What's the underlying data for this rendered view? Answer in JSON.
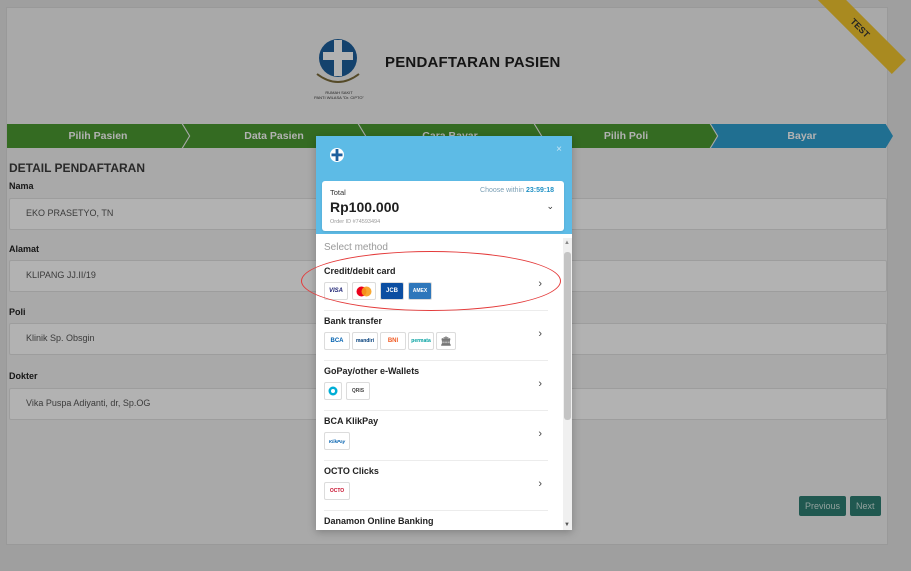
{
  "header": {
    "title": "PENDAFTARAN PASIEN",
    "logo_text_1": "RUMAH SAKIT",
    "logo_text_2": "PANTI WILASA \"Dr. CIPTO\"",
    "test_ribbon": "TEST"
  },
  "steps": [
    {
      "label": "Pilih Pasien",
      "state": "done"
    },
    {
      "label": "Data Pasien",
      "state": "done"
    },
    {
      "label": "Cara Bayar",
      "state": "done"
    },
    {
      "label": "Pilih Poli",
      "state": "done"
    },
    {
      "label": "Bayar",
      "state": "active"
    }
  ],
  "detail": {
    "section_title": "DETAIL PENDAFTARAN",
    "fields": [
      {
        "label": "Nama",
        "value": "EKO PRASETYO, TN"
      },
      {
        "label": "Alamat",
        "value": "KLIPANG JJ.II/19"
      },
      {
        "label": "Poli",
        "value": "Klinik Sp. Obsgin"
      },
      {
        "label": "Dokter",
        "value": "Vika Puspa Adiyanti, dr, Sp.OG"
      }
    ]
  },
  "buttons": {
    "previous": "Previous",
    "next": "Next"
  },
  "payment_modal": {
    "close": "×",
    "total_label": "Total",
    "total_amount": "Rp100.000",
    "order_id": "Order ID #74593494",
    "choose_within": "Choose within",
    "timer": "23:59:18",
    "select_method": "Select method",
    "methods": [
      {
        "name": "Credit/debit card",
        "icons": [
          "VISA",
          "mastercard",
          "JCB",
          "AMEX"
        ]
      },
      {
        "name": "Bank transfer",
        "icons": [
          "BCA",
          "mandiri",
          "BNI",
          "permata",
          "bank"
        ]
      },
      {
        "name": "GoPay/other e-Wallets",
        "icons": [
          "gopay",
          "QRIS"
        ]
      },
      {
        "name": "BCA KlikPay",
        "icons": [
          "KlikPay"
        ]
      },
      {
        "name": "OCTO Clicks",
        "icons": [
          "OCTO"
        ]
      },
      {
        "name": "Danamon Online Banking",
        "icons": []
      }
    ]
  },
  "colors": {
    "step_done": "#4b9a32",
    "step_active": "#2f9fd0",
    "modal_header": "#5dbbe6",
    "annotation": "#e43b3b"
  }
}
